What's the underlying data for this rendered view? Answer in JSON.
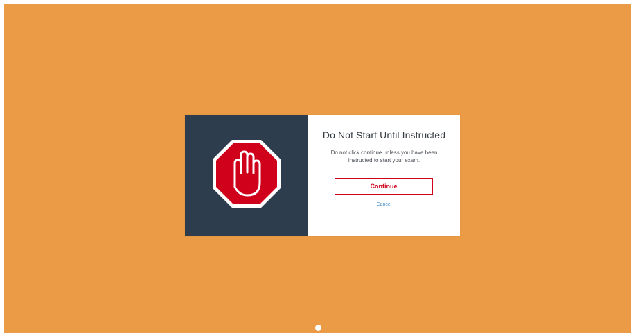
{
  "dialog": {
    "title": "Do Not Start Until Instructed",
    "message": "Do not click continue unless you have been instructed to start your exam.",
    "continue_label": "Continue",
    "cancel_label": "Cancel",
    "icon": "stop-hand-icon"
  },
  "colors": {
    "background": "#eb9b45",
    "panel": "#2e3d4e",
    "accent": "#d0021b",
    "link": "#4a90c8"
  }
}
